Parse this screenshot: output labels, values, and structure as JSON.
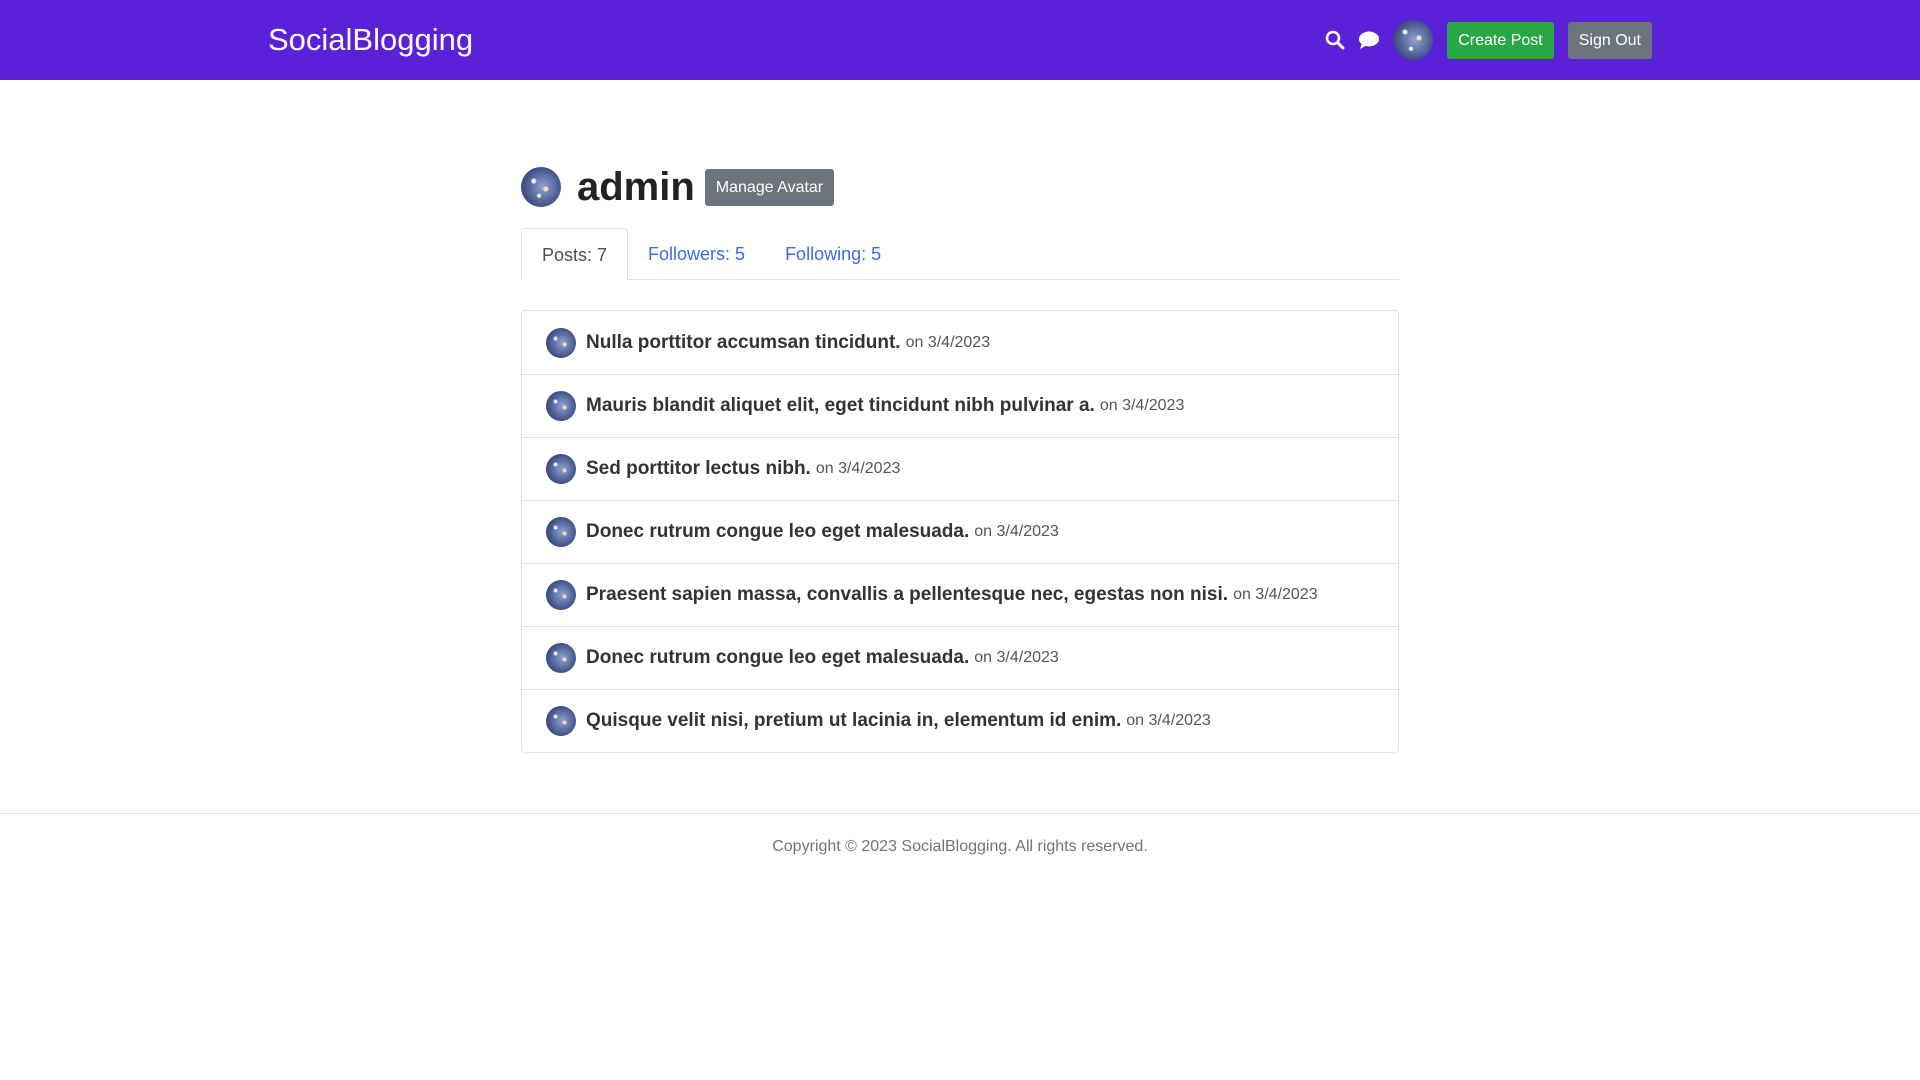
{
  "navbar": {
    "brand": "SocialBlogging",
    "search_icon": "search-icon",
    "chat_icon": "chat-icon",
    "create_post_label": "Create Post",
    "sign_out_label": "Sign Out",
    "bg_color": "#5b21d9"
  },
  "profile": {
    "username": "admin",
    "manage_avatar_label": "Manage Avatar"
  },
  "tabs": [
    {
      "label": "Posts: 7",
      "active": true
    },
    {
      "label": "Followers: 5",
      "active": false
    },
    {
      "label": "Following: 5",
      "active": false
    }
  ],
  "posts": [
    {
      "title": "Nulla porttitor accumsan tincidunt.",
      "date": "on 3/4/2023"
    },
    {
      "title": "Mauris blandit aliquet elit, eget tincidunt nibh pulvinar a.",
      "date": "on 3/4/2023"
    },
    {
      "title": "Sed porttitor lectus nibh.",
      "date": "on 3/4/2023"
    },
    {
      "title": "Donec rutrum congue leo eget malesuada.",
      "date": "on 3/4/2023"
    },
    {
      "title": "Praesent sapien massa, convallis a pellentesque nec, egestas non nisi.",
      "date": "on 3/4/2023"
    },
    {
      "title": "Donec rutrum congue leo eget malesuada.",
      "date": "on 3/4/2023"
    },
    {
      "title": "Quisque velit nisi, pretium ut lacinia in, elementum id enim.",
      "date": "on 3/4/2023"
    }
  ],
  "footer": {
    "copyright": "Copyright © 2023 SocialBlogging. All rights reserved."
  }
}
